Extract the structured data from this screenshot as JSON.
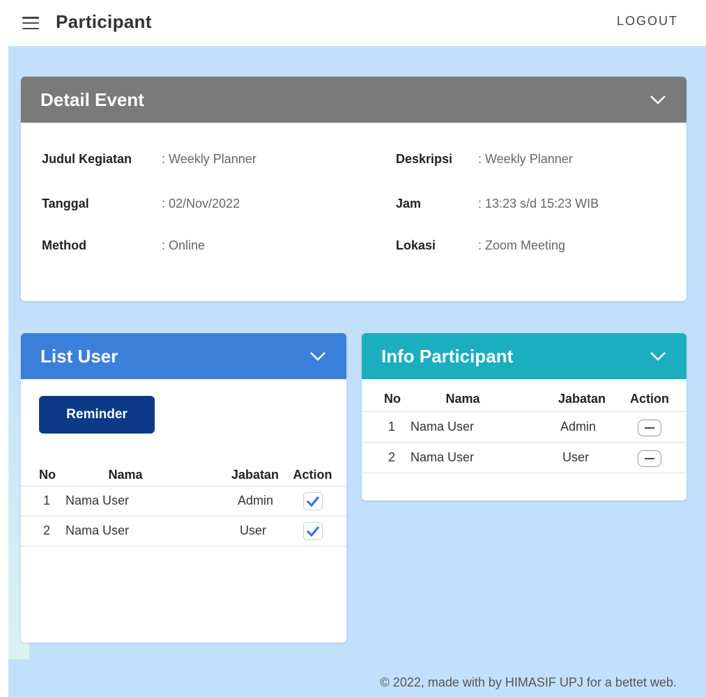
{
  "appbar": {
    "title": "Participant",
    "logout_label": "LOGOUT"
  },
  "colors": {
    "canvas": "#c2e0fb",
    "detail_header": "#7a7a7a",
    "list_user_header": "#3a7fd9",
    "info_header": "#1aaebf",
    "reminder_button": "#0c3a86"
  },
  "detail_event": {
    "title": "Detail Event",
    "fields": [
      {
        "label": "Judul Kegiatan",
        "value": ": Weekly Planner"
      },
      {
        "label": "Deskripsi",
        "value": ": Weekly Planner"
      },
      {
        "label": "Tanggal",
        "value": ": 02/Nov/2022"
      },
      {
        "label": "Jam",
        "value": ": 13:23 s/d 15:23 WIB"
      },
      {
        "label": "Method",
        "value": ": Online"
      },
      {
        "label": "Lokasi",
        "value": ": Zoom Meeting"
      }
    ]
  },
  "list_user": {
    "title": "List User",
    "reminder_label": "Reminder",
    "columns": [
      "No",
      "Nama",
      "Jabatan",
      "Action"
    ],
    "rows": [
      {
        "no": "1",
        "nama": "Nama User",
        "jabatan": "Admin",
        "checked": true
      },
      {
        "no": "2",
        "nama": "Nama User",
        "jabatan": "User",
        "checked": true
      }
    ]
  },
  "info_participant": {
    "title": "Info Participant",
    "columns": [
      "No",
      "Nama",
      "Jabatan",
      "Action"
    ],
    "rows": [
      {
        "no": "1",
        "nama": "Nama User",
        "jabatan": "Admin"
      },
      {
        "no": "2",
        "nama": "Nama User",
        "jabatan": "User"
      }
    ]
  },
  "footer": {
    "text": "© 2022, made with by HIMASIF UPJ for a bettet web."
  }
}
